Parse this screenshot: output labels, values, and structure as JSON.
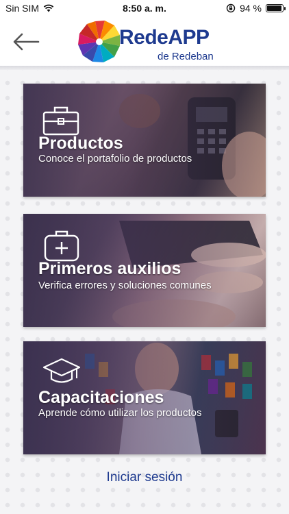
{
  "status_bar": {
    "carrier": "Sin SIM",
    "time": "8:50 a. m.",
    "battery_percent": "94 %",
    "battery_level": 0.94,
    "icons": [
      "wifi-icon",
      "orientation-lock-icon",
      "battery-icon"
    ]
  },
  "header": {
    "back_icon": "arrow-left-icon",
    "logo_title": "RedeAPP",
    "logo_subtitle": "de Redeban"
  },
  "cards": [
    {
      "icon": "briefcase-icon",
      "title": "Productos",
      "subtitle": "Conoce el portafolio de productos"
    },
    {
      "icon": "first-aid-kit-icon",
      "title": "Primeros auxilios",
      "subtitle": "Verifica errores y soluciones comunes"
    },
    {
      "icon": "graduation-cap-icon",
      "title": "Capacitaciones",
      "subtitle": "Aprende cómo utilizar los productos"
    }
  ],
  "login_link": "Iniciar sesión",
  "colors": {
    "brand_blue": "#1e3a8f",
    "background": "#f4f4f6"
  }
}
